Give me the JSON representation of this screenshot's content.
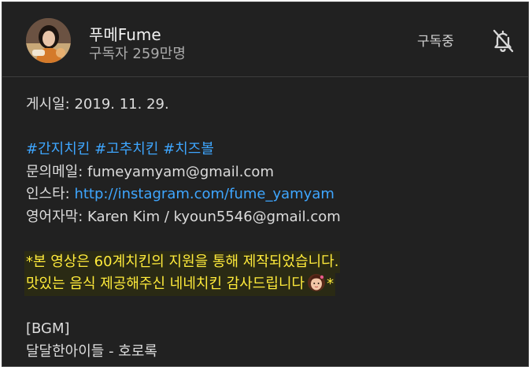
{
  "channel": {
    "name": "푸메Fume",
    "subscribers": "구독자 259만명",
    "subscribe_state": "구독중",
    "bell_icon": "bell-off-icon"
  },
  "description": {
    "posted": "게시일: 2019. 11. 29.",
    "hashtags": [
      "#간지치킨",
      "#고추치킨",
      "#치즈볼"
    ],
    "inquiry_label": "문의메일: ",
    "inquiry_value": "fumeyamyam@gmail.com",
    "instagram_label": "인스타: ",
    "instagram_link": "http://instagram.com/fume_yamyam",
    "subtitle_label": "영어자막: ",
    "subtitle_value": "Karen Kim / kyoun5546@gmail.com",
    "sponsor_line1": "*본 영상은 60계치킨의 지원을 통해 제작되었습니다.",
    "sponsor_line2_pre": "맛있는 음식 제공해주신 네네치킨 감사드립니다",
    "sponsor_line2_post": "*",
    "sponsor_emoji": "girl-face-emoji",
    "bgm_label": "[BGM]",
    "bgm_track": "달달한아이들 - 호로록"
  },
  "colors": {
    "background": "#212121",
    "link": "#3ea6ff",
    "highlight_text": "#ffeb3b",
    "muted_text": "#aaaaaa"
  }
}
